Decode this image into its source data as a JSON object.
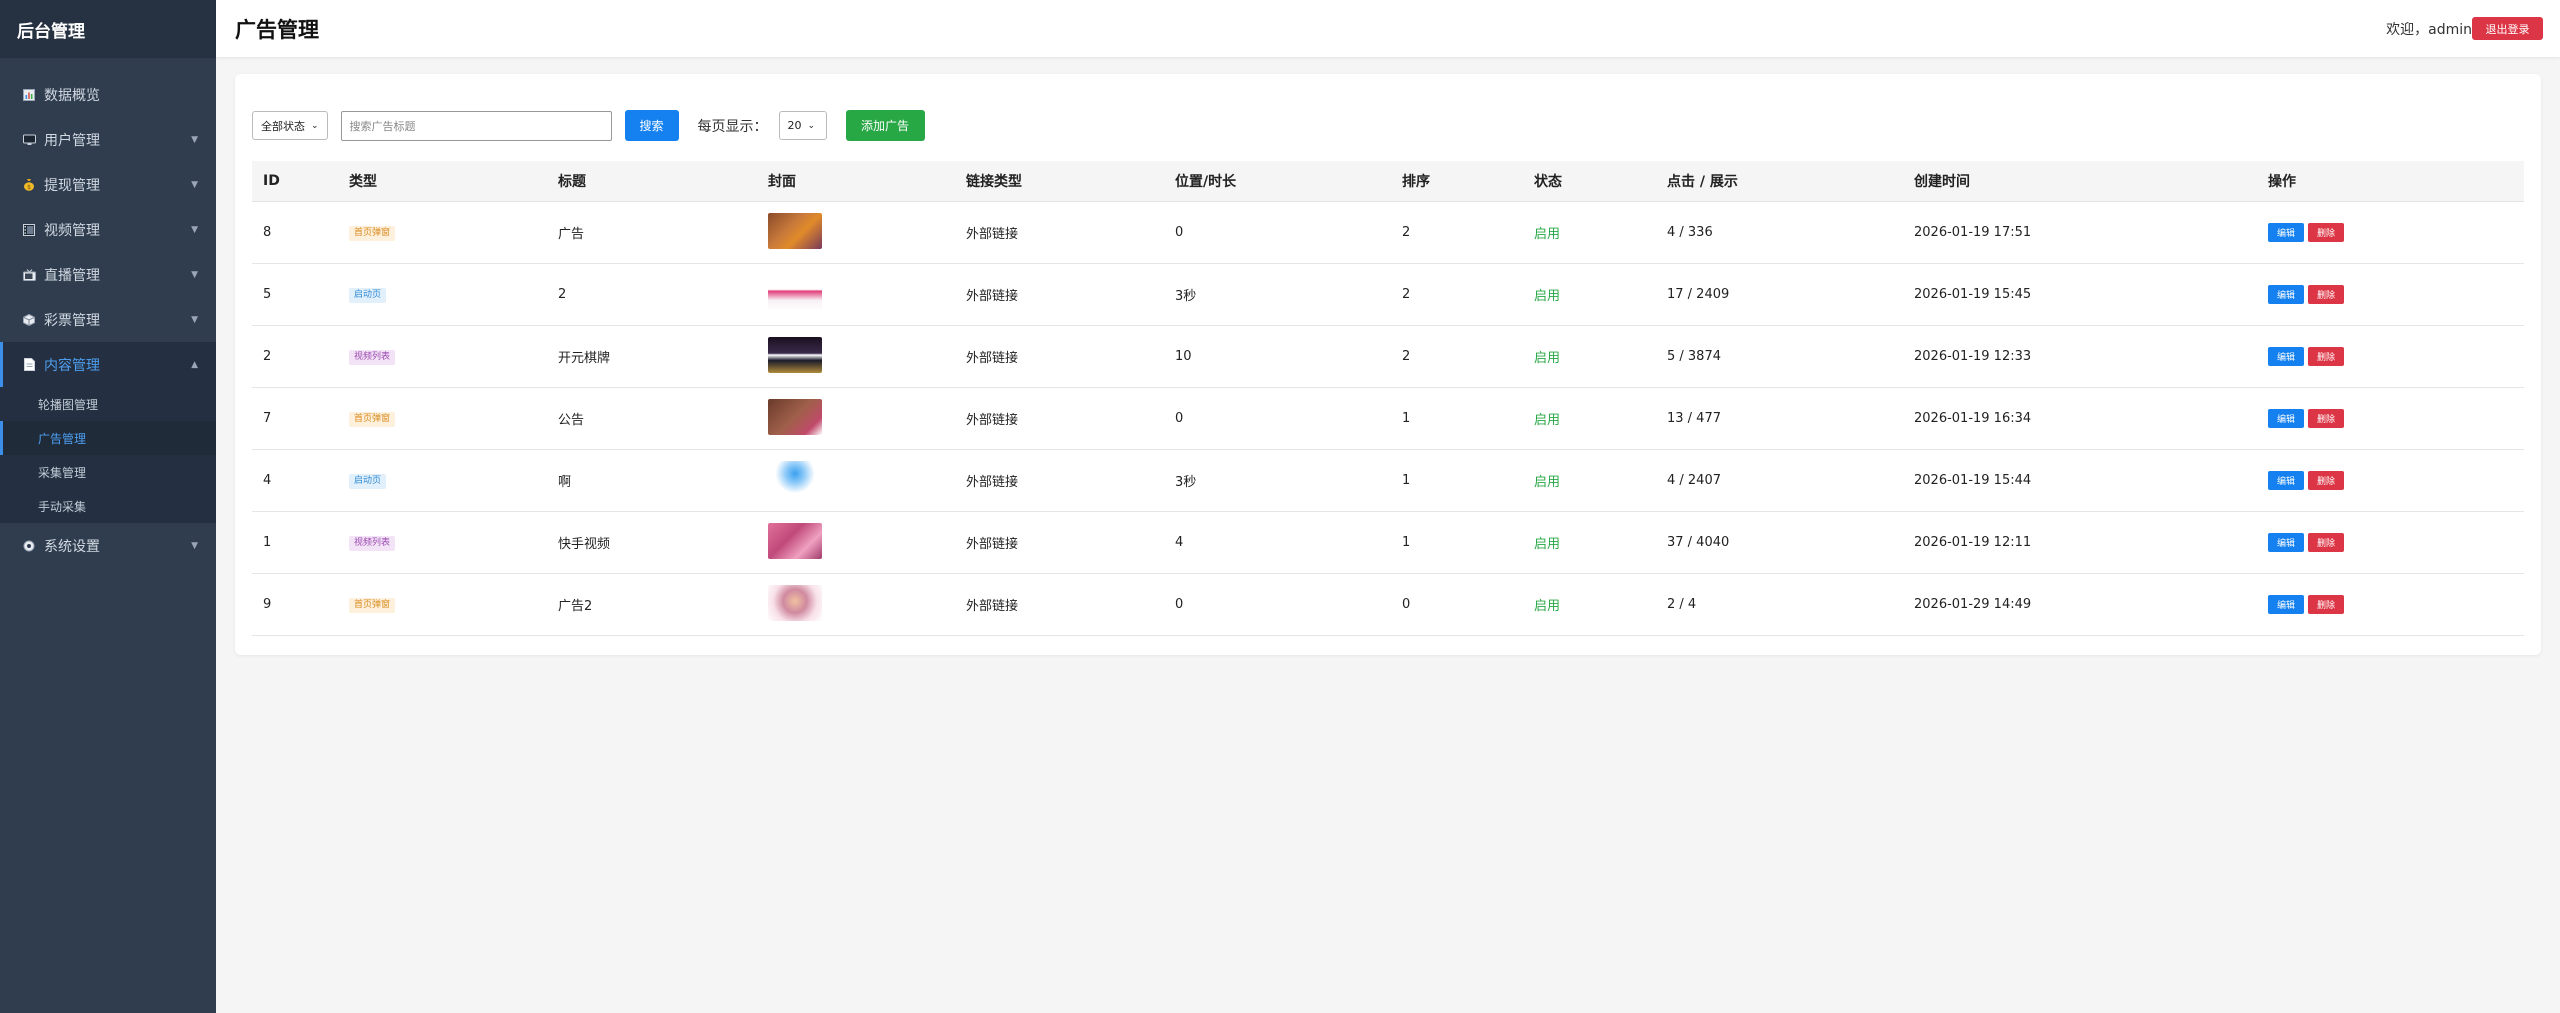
{
  "sidebar": {
    "brand": "后台管理",
    "items": [
      {
        "label": "数据概览",
        "icon": "chart-icon",
        "has_arrow": false
      },
      {
        "label": "用户管理",
        "icon": "monitor-icon",
        "has_arrow": true
      },
      {
        "label": "提现管理",
        "icon": "money-bag-icon",
        "has_arrow": true
      },
      {
        "label": "视频管理",
        "icon": "film-icon",
        "has_arrow": true
      },
      {
        "label": "直播管理",
        "icon": "tv-icon",
        "has_arrow": true
      },
      {
        "label": "彩票管理",
        "icon": "cube-icon",
        "has_arrow": true
      },
      {
        "label": "内容管理",
        "icon": "document-icon",
        "has_arrow": true,
        "active": true
      },
      {
        "label": "系统设置",
        "icon": "gear-icon",
        "has_arrow": true
      }
    ],
    "sub_items": [
      {
        "label": "轮播图管理"
      },
      {
        "label": "广告管理",
        "active": true
      },
      {
        "label": "采集管理"
      },
      {
        "label": "手动采集"
      }
    ],
    "arrow_down": "▼",
    "arrow_up": "▲"
  },
  "header": {
    "title": "广告管理",
    "welcome": "欢迎，admin",
    "logout_label": "退出登录"
  },
  "toolbar": {
    "status_filter": "全部状态",
    "search_placeholder": "搜索广告标题",
    "search_label": "搜索",
    "per_page_label": "每页显示：",
    "per_page_value": "20",
    "add_label": "添加广告"
  },
  "table": {
    "columns": [
      "ID",
      "类型",
      "标题",
      "封面",
      "链接类型",
      "位置/时长",
      "排序",
      "状态",
      "点击 / 展示",
      "创建时间",
      "操作"
    ],
    "edit_label": "编辑",
    "delete_label": "删除",
    "rows": [
      {
        "id": "8",
        "type": "首页弹窗",
        "type_kind": "popup",
        "title": "广告",
        "link_type": "外部链接",
        "position": "0",
        "sort": "2",
        "status": "启用",
        "clicks": "4 / 336",
        "created": "2026-01-19 17:51",
        "cover": "cover-1"
      },
      {
        "id": "5",
        "type": "启动页",
        "type_kind": "splash",
        "title": "2",
        "link_type": "外部链接",
        "position": "3秒",
        "sort": "2",
        "status": "启用",
        "clicks": "17 / 2409",
        "created": "2026-01-19 15:45",
        "cover": "cover-2"
      },
      {
        "id": "2",
        "type": "视频列表",
        "type_kind": "video",
        "title": "开元棋牌",
        "link_type": "外部链接",
        "position": "10",
        "sort": "2",
        "status": "启用",
        "clicks": "5 / 3874",
        "created": "2026-01-19 12:33",
        "cover": "cover-3"
      },
      {
        "id": "7",
        "type": "首页弹窗",
        "type_kind": "popup",
        "title": "公告",
        "link_type": "外部链接",
        "position": "0",
        "sort": "1",
        "status": "启用",
        "clicks": "13 / 477",
        "created": "2026-01-19 16:34",
        "cover": "cover-4"
      },
      {
        "id": "4",
        "type": "启动页",
        "type_kind": "splash",
        "title": "啊",
        "link_type": "外部链接",
        "position": "3秒",
        "sort": "1",
        "status": "启用",
        "clicks": "4 / 2407",
        "created": "2026-01-19 15:44",
        "cover": "cover-5"
      },
      {
        "id": "1",
        "type": "视频列表",
        "type_kind": "video",
        "title": "快手视频",
        "link_type": "外部链接",
        "position": "4",
        "sort": "1",
        "status": "启用",
        "clicks": "37 / 4040",
        "created": "2026-01-19 12:11",
        "cover": "cover-6"
      },
      {
        "id": "9",
        "type": "首页弹窗",
        "type_kind": "popup",
        "title": "广告2",
        "link_type": "外部链接",
        "position": "0",
        "sort": "0",
        "status": "启用",
        "clicks": "2 / 4",
        "created": "2026-01-29 14:49",
        "cover": "cover-7"
      }
    ]
  },
  "colors": {
    "sidebar_bg": "#2f3d4f",
    "accent": "#1581f0",
    "danger": "#dc3545",
    "success": "#28a745",
    "badge_popup_bg": "#fdf0dc",
    "badge_popup_fg": "#d98a1c",
    "badge_splash_bg": "#e2f0fb",
    "badge_splash_fg": "#2f8ad6",
    "badge_video_bg": "#f3e3f7",
    "badge_video_fg": "#9b4bb0"
  }
}
